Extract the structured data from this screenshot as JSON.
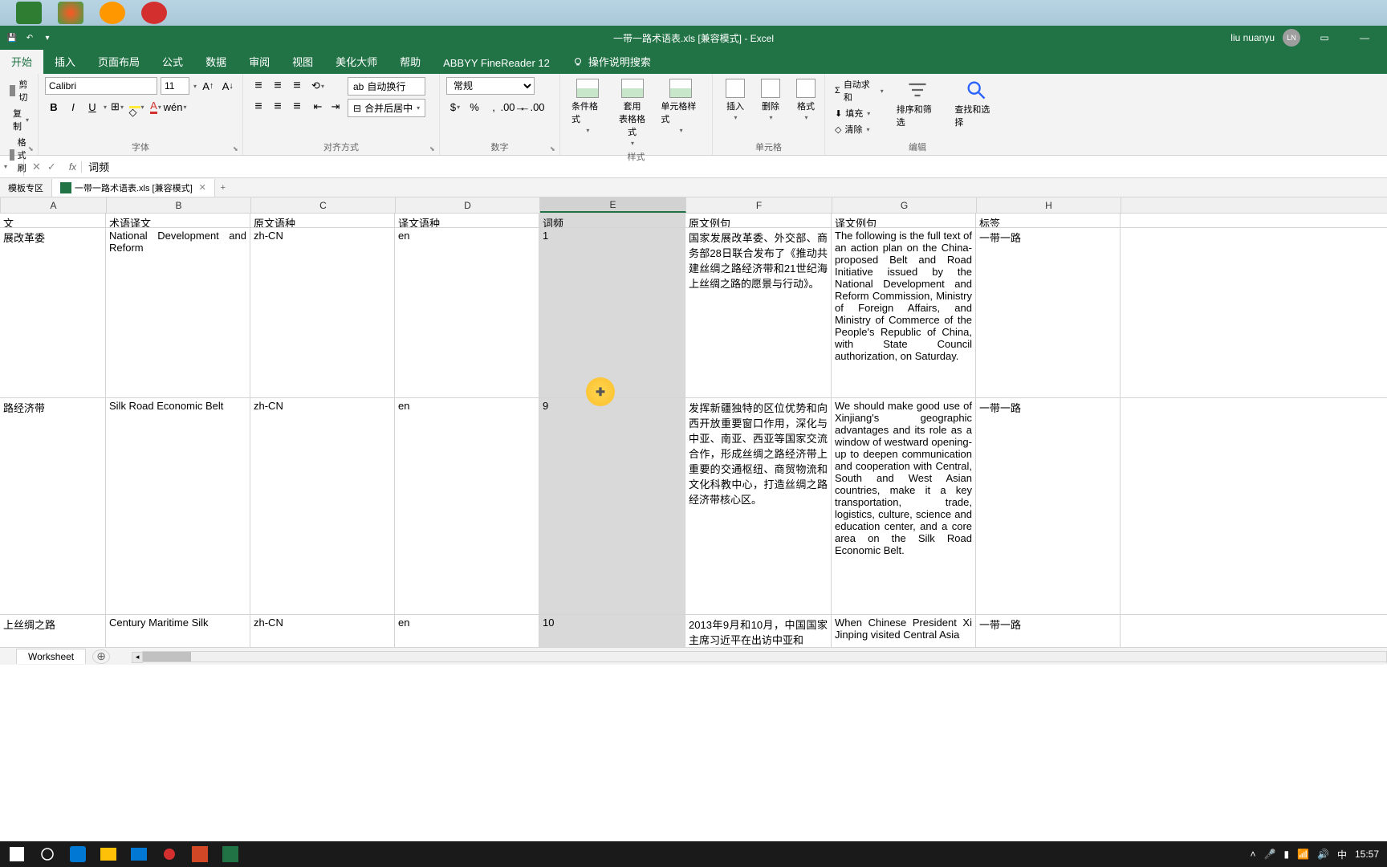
{
  "app_name": "Excel",
  "title_full": "一带一路术语表.xls [兼容模式] - Excel",
  "user": {
    "name": "liu nuanyu",
    "initials": "LN"
  },
  "ribbon_tabs": [
    "开始",
    "插入",
    "页面布局",
    "公式",
    "数据",
    "审阅",
    "视图",
    "美化大师",
    "帮助",
    "ABBYY FineReader 12"
  ],
  "tell_me": "操作说明搜索",
  "clipboard": {
    "cut": "剪切",
    "copy": "复制",
    "paint": "格式刷",
    "group": ""
  },
  "font": {
    "name": "Calibri",
    "size": "11",
    "group": "字体",
    "bold": "B",
    "italic": "I",
    "underline": "U"
  },
  "alignment": {
    "group": "对齐方式",
    "wrap": "自动换行",
    "merge": "合并后居中"
  },
  "number": {
    "format": "常规",
    "group": "数字"
  },
  "styles": {
    "cond": "条件格式",
    "table": "套用\n表格格式",
    "cell": "单元格样式",
    "group": "样式"
  },
  "cells": {
    "insert": "插入",
    "delete": "删除",
    "format": "格式",
    "group": "单元格"
  },
  "editing": {
    "sum": "自动求和",
    "fill": "填充",
    "clear": "清除",
    "sort": "排序和筛选",
    "find": "查找和选择",
    "group": "编辑"
  },
  "formula_bar": {
    "value": "词频"
  },
  "doc_tabs": {
    "template": "模板专区",
    "file": "一带一路术语表.xls [兼容模式]"
  },
  "columns": [
    "A",
    "B",
    "C",
    "D",
    "E",
    "F",
    "G",
    "H"
  ],
  "headers": {
    "A": "文",
    "B": "术语译文",
    "C": "原文语种",
    "D": "译文语种",
    "E": "词频",
    "F": "原文例句",
    "G": "译文例句",
    "H": "标签"
  },
  "rows": [
    {
      "A": "展改革委",
      "B": "National Development and Reform",
      "C": "zh-CN",
      "D": "en",
      "E": "1",
      "F": "国家发展改革委、外交部、商务部28日联合发布了《推动共建丝绸之路经济带和21世纪海上丝绸之路的愿景与行动》。",
      "G": "The following is the full text of an action plan on the China-proposed Belt and Road Initiative issued by the National Development and Reform Commission, Ministry of Foreign Affairs, and Ministry of Commerce of the People's Republic of China, with State Council authorization, on Saturday.",
      "H": "一带一路"
    },
    {
      "A": "路经济带",
      "B": "Silk Road Economic Belt",
      "C": "zh-CN",
      "D": "en",
      "E": "9",
      "F": "发挥新疆独特的区位优势和向西开放重要窗口作用，深化与中亚、南亚、西亚等国家交流合作，形成丝绸之路经济带上重要的交通枢纽、商贸物流和文化科教中心，打造丝绸之路经济带核心区。",
      "G": "We should make good use of Xinjiang's geographic advantages and its role as a window of westward opening-up to deepen communication and cooperation with Central, South and West Asian countries, make it a key transportation, trade, logistics, culture, science and education center, and a core area on the Silk Road Economic Belt.",
      "H": "一带一路"
    },
    {
      "A": "上丝绸之路",
      "B": "Century Maritime Silk",
      "C": "zh-CN",
      "D": "en",
      "E": "10",
      "F": "2013年9月和10月，中国国家主席习近平在出访中亚和",
      "G": "When Chinese President Xi Jinping visited Central Asia",
      "H": "一带一路"
    }
  ],
  "sheet": {
    "name": "Worksheet"
  },
  "taskbar": {
    "ime": "中",
    "time": "15:57"
  }
}
